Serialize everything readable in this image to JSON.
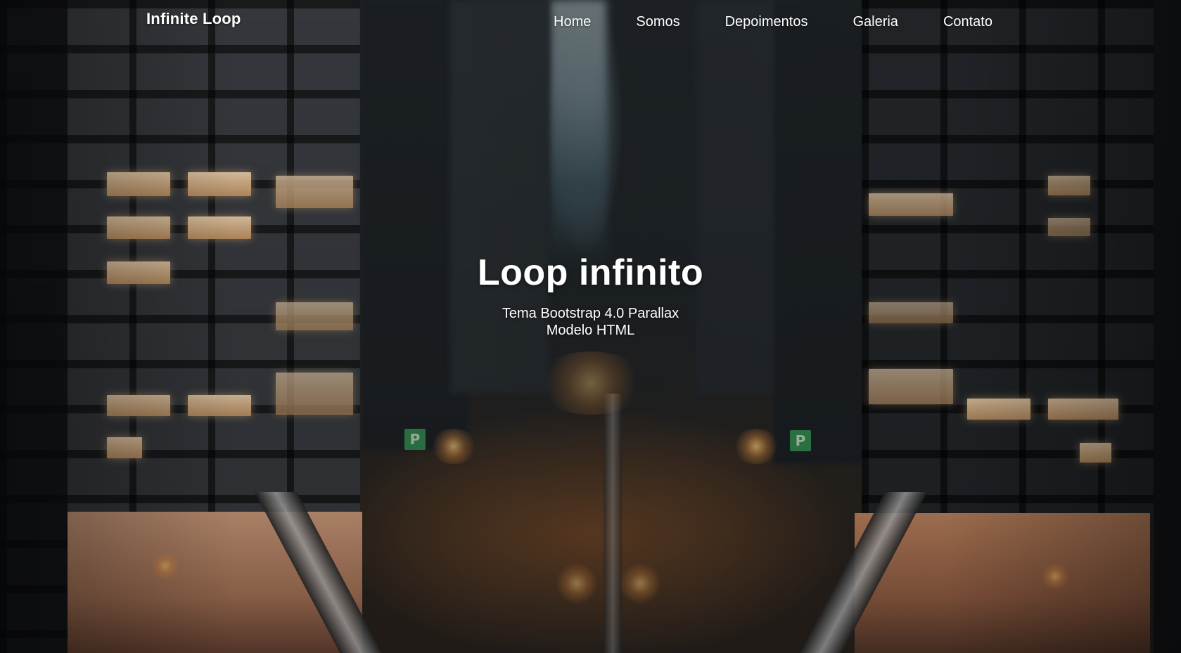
{
  "navbar": {
    "brand": "Infinite Loop",
    "links": [
      {
        "label": "Home"
      },
      {
        "label": "Somos"
      },
      {
        "label": "Depoimentos"
      },
      {
        "label": "Galeria"
      },
      {
        "label": "Contato"
      }
    ]
  },
  "hero": {
    "title": "Loop infinito",
    "subtitle_line1": "Tema Bootstrap 4.0 Parallax",
    "subtitle_line2": "Modelo HTML"
  },
  "background": {
    "description_icon": "city-night-photo",
    "signs": [
      "P",
      "P"
    ]
  },
  "colors": {
    "text": "#ffffff",
    "window_light": "#f4d7b2",
    "street_glow": "#d67830",
    "sign_green": "#3aa55b"
  }
}
